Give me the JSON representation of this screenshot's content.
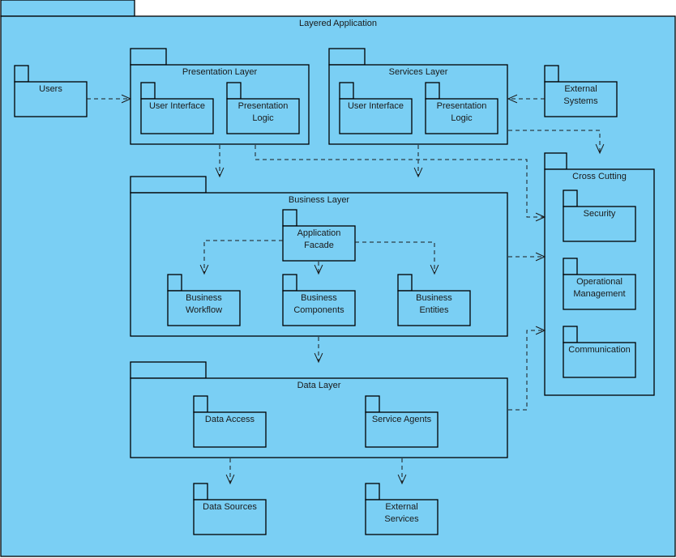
{
  "diagram": {
    "title": "Layered Application",
    "colors": {
      "package_fill": "#7acff4",
      "stroke": "#000000",
      "text": "#1a1a1a"
    },
    "packages": {
      "root": {
        "label": [
          "Layered Application"
        ]
      },
      "users": {
        "label": [
          "Users"
        ]
      },
      "presentation": {
        "label": [
          "Presentation Layer"
        ]
      },
      "pres_ui": {
        "label": [
          "User Interface"
        ]
      },
      "pres_logic": {
        "label": [
          "Presentation",
          "Logic"
        ]
      },
      "services": {
        "label": [
          "Services Layer"
        ]
      },
      "svc_ui": {
        "label": [
          "User Interface"
        ]
      },
      "svc_logic": {
        "label": [
          "Presentation",
          "Logic"
        ]
      },
      "external_systems": {
        "label": [
          "External",
          "Systems"
        ]
      },
      "business": {
        "label": [
          "Business Layer"
        ]
      },
      "app_facade": {
        "label": [
          "Application",
          "Facade"
        ]
      },
      "biz_workflow": {
        "label": [
          "Business",
          "Workflow"
        ]
      },
      "biz_components": {
        "label": [
          "Business",
          "Components"
        ]
      },
      "biz_entities": {
        "label": [
          "Business",
          "Entities"
        ]
      },
      "cross_cutting": {
        "label": [
          "Cross Cutting"
        ]
      },
      "security": {
        "label": [
          "Security"
        ]
      },
      "op_mgmt": {
        "label": [
          "Operational",
          "Management"
        ]
      },
      "communication": {
        "label": [
          "Communication"
        ]
      },
      "data": {
        "label": [
          "Data Layer"
        ]
      },
      "data_access": {
        "label": [
          "Data Access"
        ]
      },
      "service_agents": {
        "label": [
          "Service Agents"
        ]
      },
      "data_sources": {
        "label": [
          "Data Sources"
        ]
      },
      "external_services": {
        "label": [
          "External",
          "Services"
        ]
      }
    },
    "dependencies": [
      {
        "from": "users",
        "to": "presentation"
      },
      {
        "from": "external_systems",
        "to": "services"
      },
      {
        "from": "presentation",
        "to": "business"
      },
      {
        "from": "presentation",
        "to": "cross_cutting"
      },
      {
        "from": "services",
        "to": "business"
      },
      {
        "from": "services",
        "to": "cross_cutting"
      },
      {
        "from": "app_facade",
        "to": "biz_workflow"
      },
      {
        "from": "app_facade",
        "to": "biz_components"
      },
      {
        "from": "app_facade",
        "to": "biz_entities"
      },
      {
        "from": "business",
        "to": "cross_cutting"
      },
      {
        "from": "business",
        "to": "data"
      },
      {
        "from": "data",
        "to": "cross_cutting"
      },
      {
        "from": "data",
        "to": "data_sources"
      },
      {
        "from": "data",
        "to": "external_services"
      }
    ]
  }
}
